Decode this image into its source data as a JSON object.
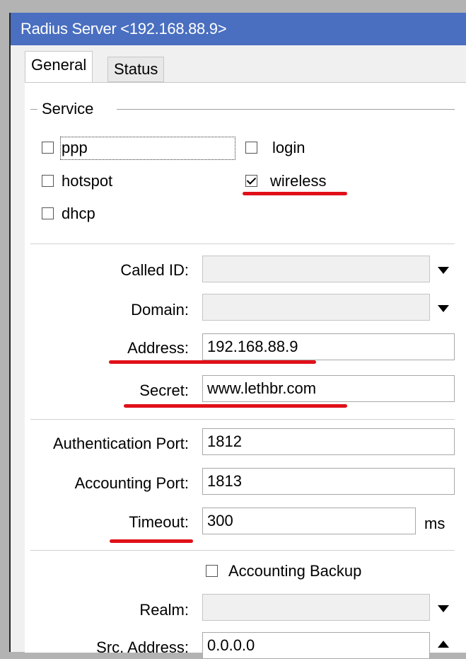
{
  "window": {
    "title": "Radius Server <192.168.88.9>"
  },
  "tabs": [
    {
      "label": "General"
    },
    {
      "label": "Status"
    }
  ],
  "service": {
    "legend": "Service",
    "options": {
      "ppp": {
        "label": "ppp",
        "checked": false
      },
      "login": {
        "label": "login",
        "checked": false
      },
      "hotspot": {
        "label": "hotspot",
        "checked": false
      },
      "wireless": {
        "label": "wireless",
        "checked": true
      },
      "dhcp": {
        "label": "dhcp",
        "checked": false
      }
    }
  },
  "fields": {
    "called_id": {
      "label": "Called ID:",
      "value": ""
    },
    "domain": {
      "label": "Domain:",
      "value": ""
    },
    "address": {
      "label": "Address:",
      "value": "192.168.88.9"
    },
    "secret": {
      "label": "Secret:",
      "value": "www.lethbr.com"
    },
    "auth_port": {
      "label": "Authentication Port:",
      "value": "1812"
    },
    "acct_port": {
      "label": "Accounting Port:",
      "value": "1813"
    },
    "timeout": {
      "label": "Timeout:",
      "value": "300",
      "unit": "ms"
    },
    "accounting_backup": {
      "label": "Accounting Backup",
      "checked": false
    },
    "realm": {
      "label": "Realm:",
      "value": ""
    },
    "src_address": {
      "label": "Src. Address:",
      "value": "0.0.0.0"
    }
  },
  "colors": {
    "titlebar": "#4a6fc0",
    "annotation_underline": "#e0101a"
  }
}
